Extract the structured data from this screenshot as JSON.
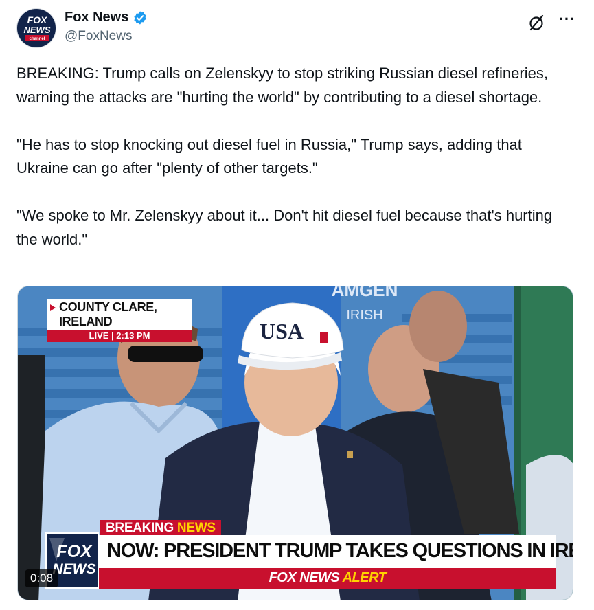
{
  "author": {
    "display_name": "Fox News",
    "handle": "@FoxNews",
    "avatar_text_top": "FOX",
    "avatar_text_mid": "NEWS",
    "avatar_text_bottom": "channel",
    "verified_color": "#1d9bf0"
  },
  "actions": {
    "grok_icon": "slashed-circle-icon",
    "more_icon": "more-dots-icon",
    "more_label": "···"
  },
  "tweet": {
    "paragraphs": [
      "BREAKING: Trump calls on Zelenskyy to stop striking Russian diesel refineries, warning the attacks are \"hurting the world\" by contributing to a diesel shortage.",
      "\"He has to stop knocking out diesel fuel in Russia,\" Trump says, adding that Ukraine can go after \"plenty of other targets.\"",
      "\"We spoke to Mr. Zelenskyy about it... Don't hit diesel fuel because that's hurting the world.\""
    ]
  },
  "video": {
    "location": "COUNTY CLARE, IRELAND",
    "live_label": "LIVE | 2:13 PM",
    "breaking_prefix": "BREAKING",
    "breaking_suffix": "NEWS",
    "headline": "NOW: PRESIDENT TRUMP TAKES QUESTIONS IN IRELAND",
    "alert_prefix": "FOX NEWS",
    "alert_suffix": "ALERT",
    "logo_top": "FOX",
    "logo_bottom": "NEWS",
    "cap_text": "USA",
    "sign_top": "AMGEN",
    "sign_bottom": "IRISH",
    "elapsed": "0:08",
    "accent_red": "#c8102e",
    "accent_yellow": "#ffd200"
  }
}
